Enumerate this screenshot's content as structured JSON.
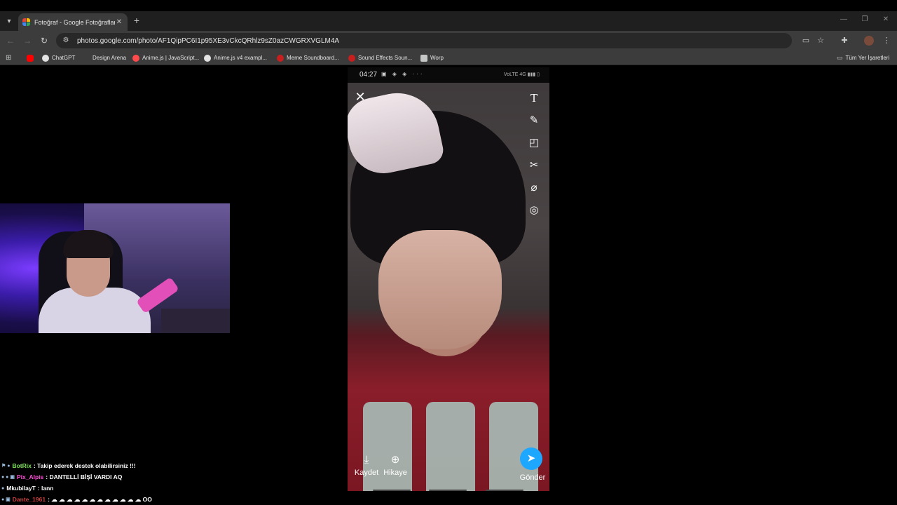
{
  "browser": {
    "tab_title": "Fotoğraf - Google Fotoğraflar",
    "url": "photos.google.com/photo/AF1QipPC6I1p95XE3vCkcQRhlz9sZ0azCWGRXVGLM4A",
    "bookmarks": [
      {
        "label": "ChatGPT",
        "color": "#e3e3e3"
      },
      {
        "label": "Design Arena",
        "color": "#3c3c3c"
      },
      {
        "label": "Anime.js | JavaScript...",
        "color": "#ff4b4b"
      },
      {
        "label": "Anime.js v4 exampl...",
        "color": "#e3e3e3"
      },
      {
        "label": "Meme Soundboard...",
        "color": "#c81e1e"
      },
      {
        "label": "Sound Effects Soun...",
        "color": "#c81e1e"
      },
      {
        "label": "Worp",
        "color": "#c4c7c5"
      }
    ],
    "all_bookmarks_label": "Tüm Yer İşaretleri"
  },
  "phone": {
    "time": "04:27",
    "status_icons": "▣ ◈ ◈ ···",
    "sys_icons": "VoLTE 4G ▮▮▮ ▯",
    "save_label": "Kaydet",
    "story_label": "Hikaye",
    "send_label": "Gönder"
  },
  "chat": [
    {
      "user": "BotRix",
      "user_color": "#7ee35b",
      "badges": "⚑ ●",
      "message": ": Takip ederek destek olabilirsiniz !!!"
    },
    {
      "user": "Pix_Alpis",
      "user_color": "#ff4fd8",
      "badges": "● ● ▣",
      "message": ": DANTELLİ BİŞİ VARDI AQ"
    },
    {
      "user": "MkubilayT",
      "user_color": "#ffffff",
      "badges": "●",
      "message": ": lann"
    },
    {
      "user": "Dante_1961",
      "user_color": "#c84040",
      "badges": "● ▣",
      "message": ": ☁ ☁ ☁ ☁ ☁ ☁ ☁ ☁ ☁ ☁ ☁ ☁ OO"
    }
  ],
  "colors": {
    "snap_send": "#1ea7ff",
    "chrome_toolbar": "#3c3c3c",
    "chrome_tabstrip": "#1f1f1f"
  }
}
